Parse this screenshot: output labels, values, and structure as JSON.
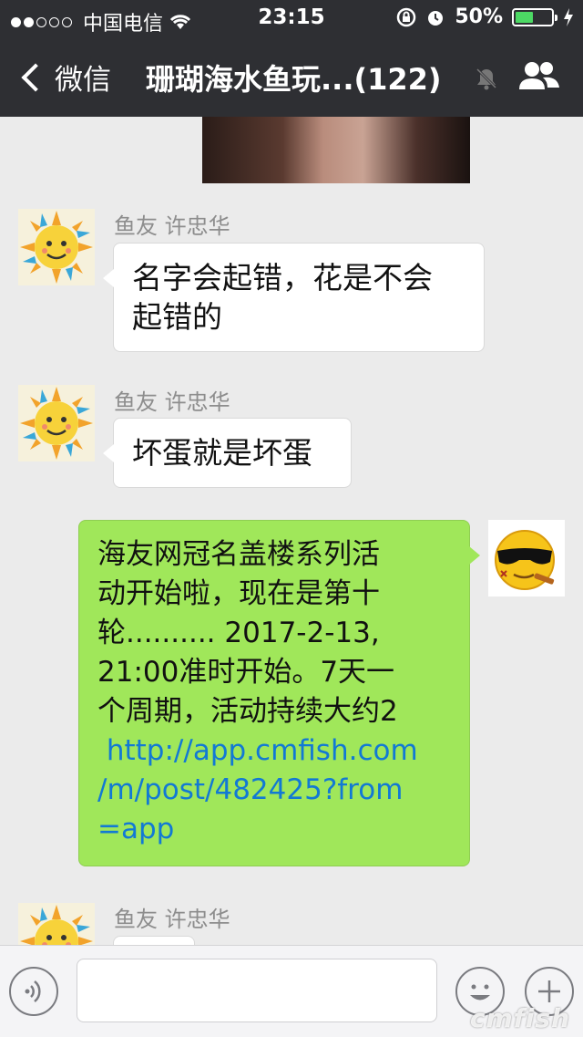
{
  "status": {
    "carrier": "中国电信",
    "time": "23:15",
    "battery": "50%",
    "battery_level": 0.5
  },
  "nav": {
    "back_label": "微信",
    "title": "珊瑚海水鱼玩...(122)"
  },
  "messages": [
    {
      "sender": "鱼友 许忠华",
      "lines": [
        "名字会起错，花是不会",
        "起错的"
      ]
    },
    {
      "sender": "鱼友 许忠华",
      "text": "坏蛋就是坏蛋"
    },
    {
      "lines": [
        "海友网冠名盖楼系列活",
        "动开始啦，现在是第十",
        "轮.......... 2017-2-13,",
        "21:00准时开始。7天一",
        "个周期，活动持续大约2"
      ],
      "link_lines": [
        " http://app.cmfish.com",
        "/m/post/482425?from",
        "=app"
      ]
    },
    {
      "sender": "鱼友 许忠华"
    }
  ],
  "input": {
    "placeholder": ""
  },
  "watermark": "cmfish"
}
